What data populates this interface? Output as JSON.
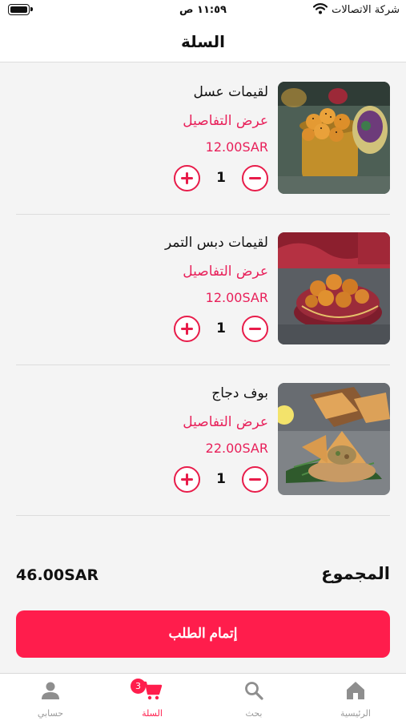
{
  "status_bar": {
    "time": "١١:٥٩ ص",
    "carrier": "شركة الاتصالات"
  },
  "header": {
    "title": "السلة"
  },
  "cart": {
    "items": [
      {
        "name": "لقيمات عسل",
        "details_label": "عرض التفاصيل",
        "price": "12.00SAR",
        "quantity": "1",
        "image_icon": "honey-luqaimat-photo"
      },
      {
        "name": "لقيمات دبس التمر",
        "details_label": "عرض التفاصيل",
        "price": "12.00SAR",
        "quantity": "1",
        "image_icon": "date-syrup-luqaimat-photo"
      },
      {
        "name": "بوف دجاج",
        "details_label": "عرض التفاصيل",
        "price": "22.00SAR",
        "quantity": "1",
        "image_icon": "chicken-puff-photo"
      }
    ]
  },
  "summary": {
    "total_label": "المجموع",
    "total_value": "46.00SAR"
  },
  "checkout": {
    "label": "إتمام الطلب"
  },
  "tab_bar": {
    "home_label": "الرئيسية",
    "search_label": "بحث",
    "cart_label": "السلة",
    "cart_badge": "3",
    "account_label": "حسابي"
  },
  "colors": {
    "accent": "#ff1d4c",
    "price_text": "#e8205a",
    "inactive_tab": "#9a9a9a",
    "background": "#f4f4f4"
  }
}
